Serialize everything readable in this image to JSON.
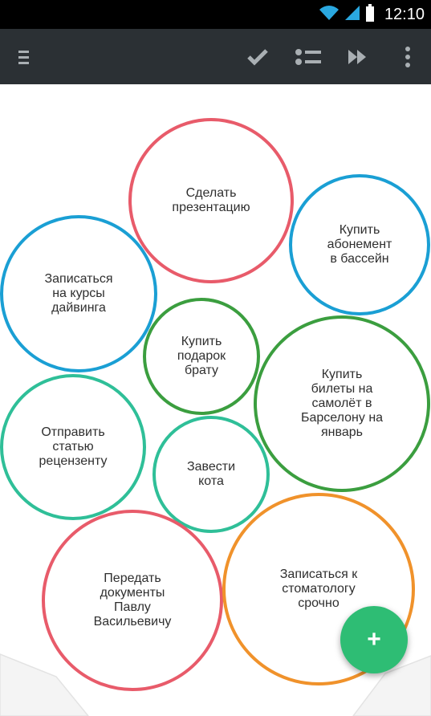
{
  "status": {
    "time": "12:10"
  },
  "toolbar": {
    "menu_icon": "menu-icon",
    "actions": [
      "checkmark-icon",
      "list-icon",
      "fast-forward-icon",
      "overflow-menu-icon"
    ]
  },
  "bubbles": [
    {
      "label": "Сделать\nпрезентацию",
      "color": "#e85b6a"
    },
    {
      "label": "Купить\nабонемент\nв бассейн",
      "color": "#1a9fd4"
    },
    {
      "label": "Записаться\nна курсы\nдайвинга",
      "color": "#1a9fd4"
    },
    {
      "label": "Купить\nподарок\nбрату",
      "color": "#3b9e3f"
    },
    {
      "label": "Купить\nбилеты на\nсамолёт в\nБарселону на\nянварь",
      "color": "#3b9e3f"
    },
    {
      "label": "Отправить\nстатью\nрецензенту",
      "color": "#2fbf98"
    },
    {
      "label": "Завести\nкота",
      "color": "#2fbf98"
    },
    {
      "label": "Передать\nдокументы\nПавлу\nВасильевичу",
      "color": "#e85b6a"
    },
    {
      "label": "Записаться к\nстоматологу\nсрочно",
      "color": "#f0922b"
    }
  ],
  "fab": {
    "label": "+",
    "color": "#2ebd74"
  }
}
